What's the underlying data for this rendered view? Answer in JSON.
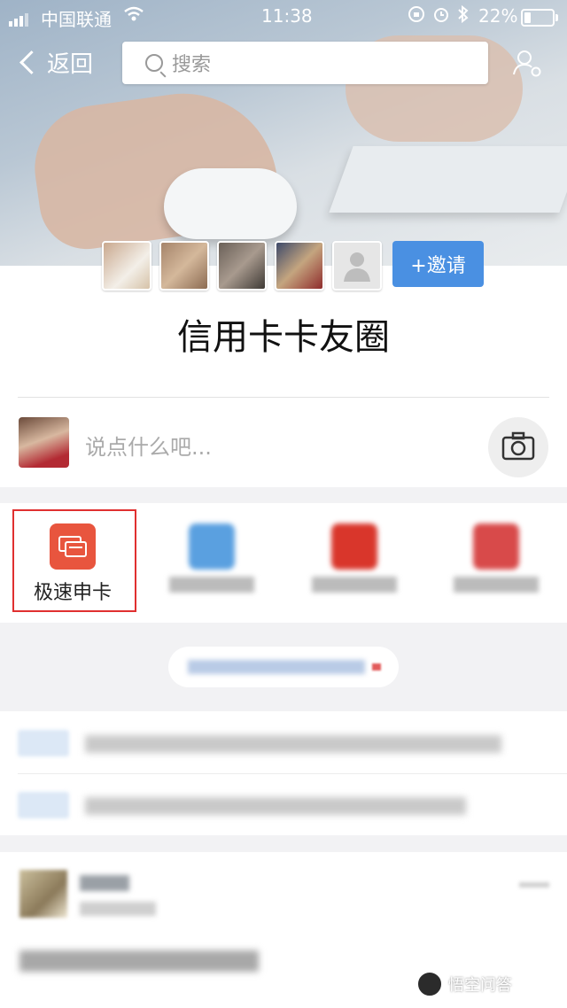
{
  "status": {
    "carrier": "中国联通",
    "time": "11:38",
    "battery": "22%"
  },
  "nav": {
    "back_label": "返回",
    "search_placeholder": "搜索"
  },
  "group": {
    "invite_label": "+邀请",
    "title": "信用卡卡友圈"
  },
  "composer": {
    "placeholder": "说点什么吧..."
  },
  "quick_actions": [
    {
      "label": "极速申卡",
      "icon": "card-icon",
      "color": "#e8553e"
    }
  ],
  "colors": {
    "accent": "#4a90e2",
    "highlight": "#e03030"
  },
  "watermark": "悟空问答"
}
